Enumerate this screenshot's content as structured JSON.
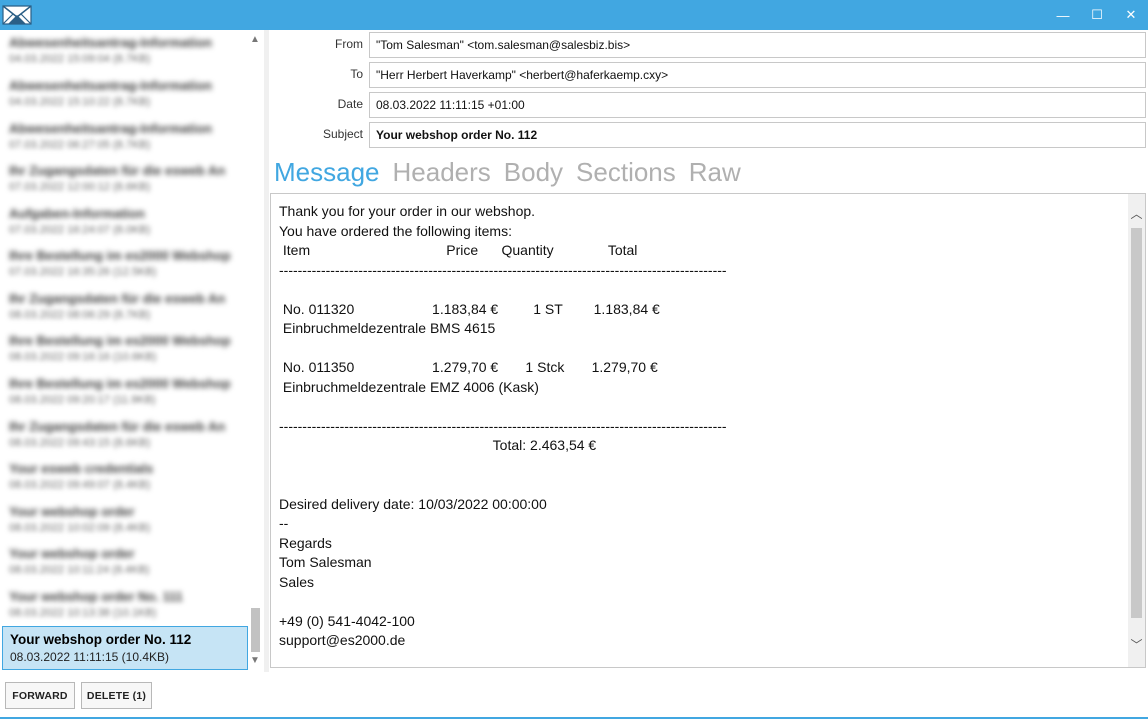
{
  "window": {
    "minimize_glyph": "—",
    "maximize_glyph": "☐",
    "close_glyph": "✕",
    "accent_color": "#41a7e1"
  },
  "message_list": {
    "items": [
      {
        "subject": "Abwesenheitsantrag-Information",
        "meta": "04.03.2022 15:09:04 (8.7KB)"
      },
      {
        "subject": "Abwesenheitsantrag-Information",
        "meta": "04.03.2022 15:10:22 (8.7KB)"
      },
      {
        "subject": "Abwesenheitsantrag-Information",
        "meta": "07.03.2022 06:27:05 (8.7KB)"
      },
      {
        "subject": "Ihr Zugangsdaten für die esweb An",
        "meta": "07.03.2022 12:00:12 (8.6KB)"
      },
      {
        "subject": "Aufgaben-Information",
        "meta": "07.03.2022 16:24:07 (8.0KB)"
      },
      {
        "subject": "Ihre Bestellung im es2000 Webshop",
        "meta": "07.03.2022 16:35:26 (12.5KB)"
      },
      {
        "subject": "Ihr Zugangsdaten für die esweb An",
        "meta": "08.03.2022 08:06:29 (8.7KB)"
      },
      {
        "subject": "Ihre Bestellung im es2000 Webshop",
        "meta": "08.03.2022 09:16:16 (10.6KB)"
      },
      {
        "subject": "Ihre Bestellung im es2000 Webshop",
        "meta": "08.03.2022 09:20:17 (11.9KB)"
      },
      {
        "subject": "Ihr Zugangsdaten für die esweb An",
        "meta": "08.03.2022 09:43:15 (8.6KB)"
      },
      {
        "subject": "Your esweb credentials",
        "meta": "08.03.2022 09:49:07 (8.4KB)"
      },
      {
        "subject": "Your webshop order",
        "meta": "08.03.2022 10:02:09 (8.4KB)"
      },
      {
        "subject": "Your webshop order",
        "meta": "08.03.2022 10:11:24 (8.4KB)"
      },
      {
        "subject": "Your webshop order No. 111",
        "meta": "08.03.2022 10:13:38 (10.1KB)"
      },
      {
        "subject": "Your webshop order No. 112",
        "meta": "08.03.2022 11:11:15 (10.4KB)",
        "selected": true
      }
    ]
  },
  "header": {
    "from_label": "From",
    "from_value": "\"Tom Salesman\" <tom.salesman@salesbiz.bis>",
    "to_label": "To",
    "to_value": "\"Herr Herbert Haverkamp\" <herbert@haferkaemp.cxy>",
    "date_label": "Date",
    "date_value": "08.03.2022 11:11:15 +01:00",
    "subject_label": "Subject",
    "subject_value": "Your webshop order No. 112"
  },
  "tabs": [
    {
      "label": "Message",
      "active": true
    },
    {
      "label": "Headers"
    },
    {
      "label": "Body"
    },
    {
      "label": "Sections"
    },
    {
      "label": "Raw"
    }
  ],
  "message_body": "Thank you for your order in our webshop.\nYou have ordered the following items:\n Item                                   Price      Quantity              Total\n------------------------------------------------------------------------------------------------\n\n No. 011320                    1.183,84 €         1 ST        1.183,84 €\n Einbruchmeldezentrale BMS 4615\n\n No. 011350                    1.279,70 €       1 Stck       1.279,70 €\n Einbruchmeldezentrale EMZ 4006 (Kask)\n\n------------------------------------------------------------------------------------------------\n                                                       Total: 2.463,54 €\n\n\nDesired delivery date: 10/03/2022 00:00:00\n--\nRegards\nTom Salesman\nSales\n\n+49 (0) 541-4042-100\nsupport@es2000.de",
  "actions": {
    "forward_label": "FORWARD",
    "delete_label": "DELETE (1)"
  }
}
